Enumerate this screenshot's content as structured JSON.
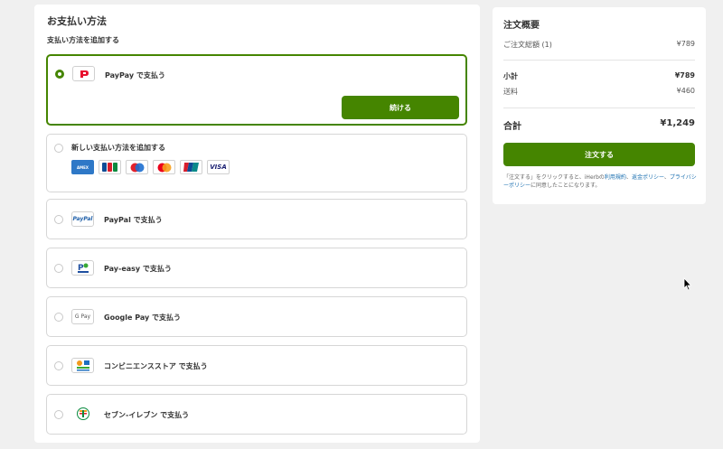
{
  "payment": {
    "title": "お支払い方法",
    "add_method_heading": "支払い方法を追加する",
    "options": [
      {
        "label": "PayPay で支払う",
        "selected": true,
        "logo_icon": "paypay-logo-icon",
        "continue_label": "続ける"
      },
      {
        "label": "新しい支払い方法を追加する",
        "selected": false
      },
      {
        "label": "PayPal で支払う",
        "selected": false,
        "logo_icon": "paypal-logo-icon",
        "logo_text": "PayPal"
      },
      {
        "label": "Pay-easy で支払う",
        "selected": false,
        "logo_icon": "payeasy-logo-icon"
      },
      {
        "label": "Google Pay で支払う",
        "selected": false,
        "logo_icon": "google-pay-logo-icon",
        "logo_text": "G Pay"
      },
      {
        "label": "コンビニエンスストア で支払う",
        "selected": false,
        "logo_icon": "convenience-store-logo-icon"
      },
      {
        "label": "セブン-イレブン で支払う",
        "selected": false,
        "logo_icon": "seven-eleven-logo-icon",
        "logo_text": "7"
      }
    ],
    "cards": [
      {
        "icon": "amex-icon",
        "text": "AMEX"
      },
      {
        "icon": "jcb-icon",
        "text": "JCB"
      },
      {
        "icon": "maestro-icon",
        "text": ""
      },
      {
        "icon": "mastercard-icon",
        "text": ""
      },
      {
        "icon": "unionpay-icon",
        "text": "UnionPay"
      },
      {
        "icon": "visa-icon",
        "text": "VISA"
      }
    ]
  },
  "summary": {
    "title": "注文概要",
    "order_total_label": "ご注文総額 (1)",
    "order_total_value": "¥789",
    "subtotal_label": "小計",
    "subtotal_value": "¥789",
    "shipping_label": "送料",
    "shipping_value": "¥460",
    "total_label": "合計",
    "total_value": "¥1,249",
    "order_button": "注文する",
    "notice_prefix": "「注文する」をクリックすると、iHerbの",
    "notice_link1": "利用規約",
    "notice_sep": "、",
    "notice_link2": "返金ポリシー",
    "notice_sep2": "、",
    "notice_link3": "プライバシーポリシー",
    "notice_suffix": "に同意したことになります。"
  },
  "colors": {
    "accent": "#458500",
    "link": "#1a6fb0"
  }
}
